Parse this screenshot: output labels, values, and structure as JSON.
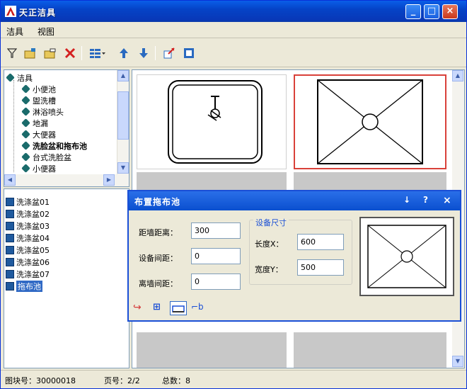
{
  "window": {
    "title": "天正洁具"
  },
  "menu": {
    "items": [
      "洁具",
      "视图"
    ]
  },
  "tree": {
    "root": "洁具",
    "children": [
      "小便池",
      "盥洗槽",
      "淋浴喷头",
      "地漏",
      "大便器",
      "洗脸盆和拖布池",
      "台式洗脸盆",
      "小便器"
    ]
  },
  "list": {
    "items": [
      "洗涤盆01",
      "洗涤盆02",
      "洗涤盆03",
      "洗涤盆04",
      "洗涤盆05",
      "洗涤盆06",
      "洗涤盆07",
      "拖布池"
    ],
    "selected_index": 7
  },
  "status": {
    "code": "图块号：30000018",
    "page": "页号：2/2",
    "count": "总数：8"
  },
  "dialog": {
    "title": "布置拖布池",
    "icons": {
      "pin": "↓",
      "help": "?",
      "close": "×"
    },
    "fields": {
      "wall_label": "距墙距离：",
      "wall_value": "300",
      "device_label": "设备间距：",
      "device_value": "0",
      "away_label": "离墙间距：",
      "away_value": "0"
    },
    "size_group": {
      "legend": "设备尺寸",
      "length_label": "长度X：",
      "length_value": "600",
      "width_label": "宽度Y：",
      "width_value": "500"
    }
  }
}
